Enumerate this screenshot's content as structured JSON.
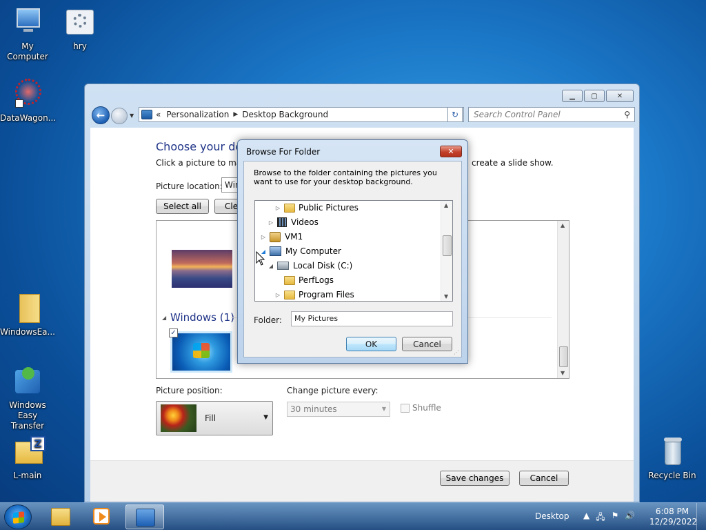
{
  "desktop": {
    "icons": [
      {
        "label": "My Computer"
      },
      {
        "label": "hry"
      },
      {
        "label": "DataWagon..."
      },
      {
        "label": "WindowsEa..."
      },
      {
        "label": "Windows Easy Transfer"
      },
      {
        "label": "L-main"
      },
      {
        "label": "Recycle Bin"
      }
    ]
  },
  "control_panel": {
    "breadcrumb": {
      "prefix": "«",
      "items": [
        "Personalization",
        "Desktop Background"
      ]
    },
    "search_placeholder": "Search Control Panel",
    "title": "Choose your desk",
    "subtitle": "Click a picture to make",
    "subtitle_end": "create a slide show.",
    "picture_location_label": "Picture location:",
    "picture_location_value": "Win",
    "select_all": "Select all",
    "clear_all": "Clea",
    "group_title": "Windows (1)",
    "picture_position_label": "Picture position:",
    "picture_position_value": "Fill",
    "change_every_label": "Change picture every:",
    "change_every_value": "30 minutes",
    "shuffle_label": "Shuffle",
    "save_changes": "Save changes",
    "cancel": "Cancel"
  },
  "dialog": {
    "title": "Browse For Folder",
    "close_glyph": "✕",
    "description": "Browse to the folder containing the pictures you want to use for your desktop background.",
    "tree": [
      {
        "label": "Public Pictures",
        "icon": "folder-icon"
      },
      {
        "label": "Videos",
        "icon": "video-icon"
      },
      {
        "label": "VM1",
        "icon": "user-folder-icon"
      },
      {
        "label": "My Computer",
        "icon": "computer-icon"
      },
      {
        "label": "Local Disk (C:)",
        "icon": "disk-icon"
      },
      {
        "label": "PerfLogs",
        "icon": "folder-icon"
      },
      {
        "label": "Program Files",
        "icon": "folder-icon"
      }
    ],
    "folder_label": "Folder:",
    "folder_value": "My Pictures",
    "ok": "OK",
    "cancel": "Cancel"
  },
  "taskbar": {
    "desktop_label": "Desktop",
    "time": "6:08 PM",
    "date": "12/29/2022"
  }
}
